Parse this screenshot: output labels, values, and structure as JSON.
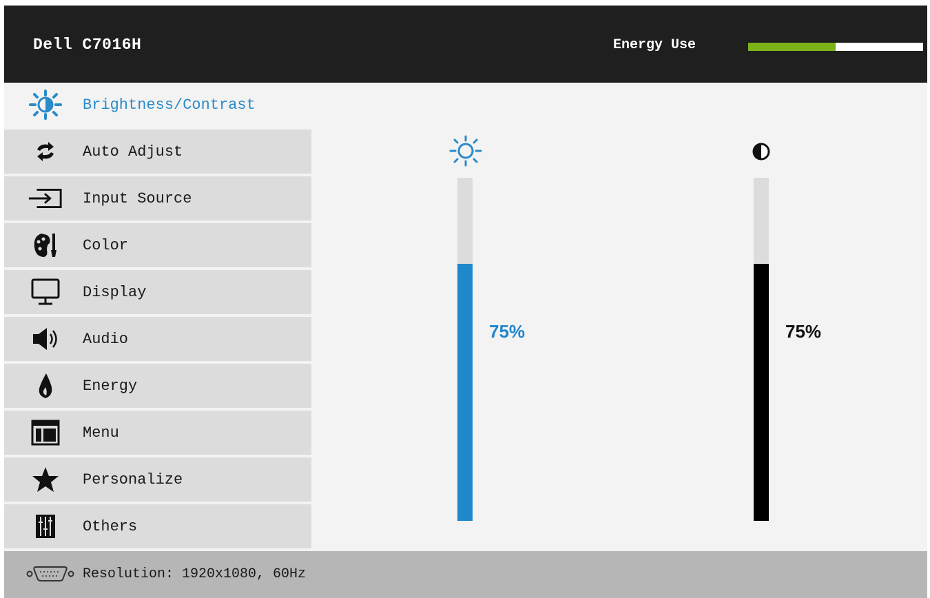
{
  "header": {
    "model": "Dell C7016H",
    "energy_label": "Energy Use",
    "energy_level": 0.5,
    "energy_color": "#7bb31a"
  },
  "sidebar": {
    "items": [
      {
        "label": "Brightness/Contrast",
        "icon": "brightness-icon",
        "active": true
      },
      {
        "label": "Auto Adjust",
        "icon": "auto-adjust-icon"
      },
      {
        "label": "Input Source",
        "icon": "input-source-icon"
      },
      {
        "label": "Color",
        "icon": "color-palette-icon"
      },
      {
        "label": "Display",
        "icon": "monitor-icon"
      },
      {
        "label": "Audio",
        "icon": "speaker-icon"
      },
      {
        "label": "Energy",
        "icon": "flame-icon"
      },
      {
        "label": "Menu",
        "icon": "menu-window-icon"
      },
      {
        "label": "Personalize",
        "icon": "star-icon"
      },
      {
        "label": "Others",
        "icon": "sliders-icon"
      }
    ]
  },
  "main": {
    "brightness": {
      "value": 75,
      "label": "75%",
      "color": "#1f87cc",
      "icon": "sun-icon"
    },
    "contrast": {
      "value": 75,
      "label": "75%",
      "color": "#000000",
      "icon": "contrast-icon"
    }
  },
  "footer": {
    "resolution": "Resolution: 1920x1080, 60Hz",
    "icon": "vga-connector-icon"
  },
  "colors": {
    "accent": "#2a8bc9",
    "header_bg": "#1f1f1f",
    "menu_item_bg": "#dcdcdc",
    "footer_bg": "#b6b6b6"
  }
}
